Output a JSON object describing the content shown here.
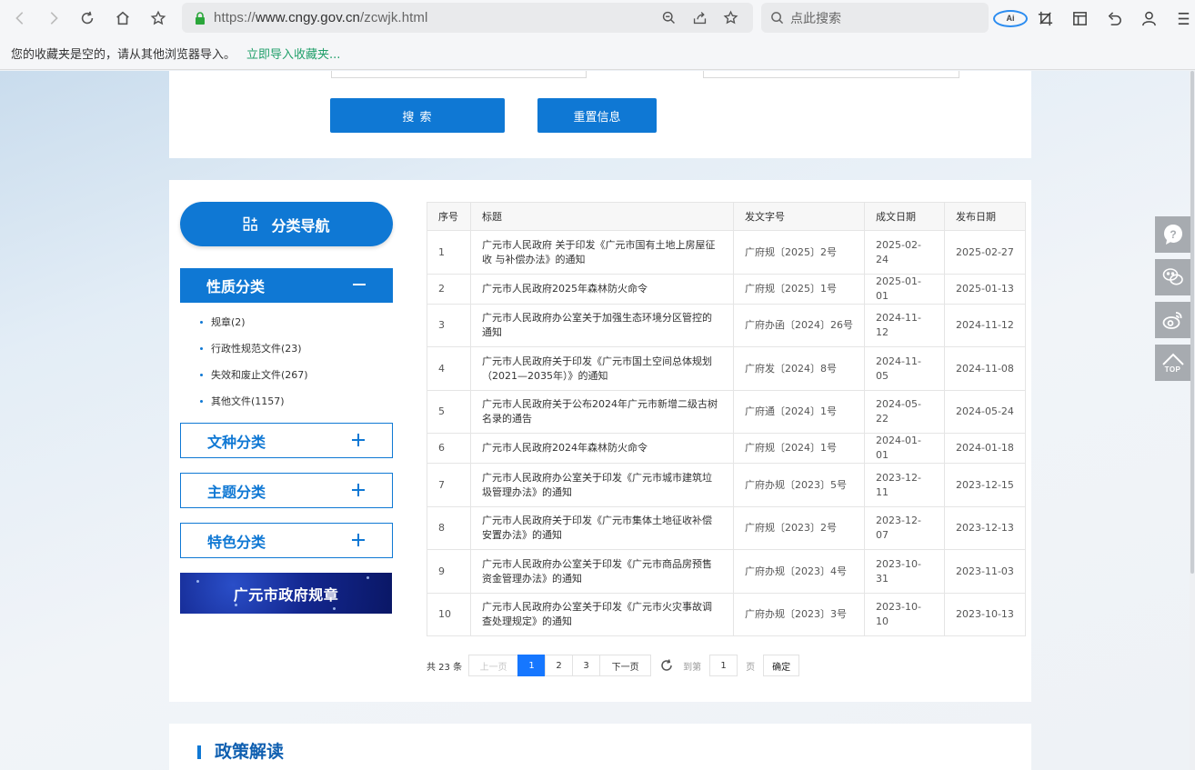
{
  "browser": {
    "url_prefix": "https://",
    "url_host": "www.cngy.gov.cn",
    "url_path": "/zcwjk.html",
    "search_placeholder": "点此搜索",
    "ai_label": "Ai",
    "favbar_message": "您的收藏夹是空的，请从其他浏览器导入。",
    "favbar_import": "立即导入收藏夹..."
  },
  "search_panel": {
    "search_button": "搜 索",
    "reset_button": "重置信息"
  },
  "sidebar": {
    "nav_title": "分类导航",
    "categories": [
      {
        "label": "性质分类",
        "expanded": true
      },
      {
        "label": "文种分类",
        "expanded": false
      },
      {
        "label": "主题分类",
        "expanded": false
      },
      {
        "label": "特色分类",
        "expanded": false
      }
    ],
    "nature_items": [
      "规章(2)",
      "行政性规范文件(23)",
      "失效和废止文件(267)",
      "其他文件(1157)"
    ],
    "banner_text": "广元市政府规章"
  },
  "table": {
    "headers": [
      "序号",
      "标题",
      "发文字号",
      "成文日期",
      "发布日期"
    ],
    "rows": [
      {
        "no": "1",
        "title": "广元市人民政府 关于印发《广元市国有土地上房屋征收 与补偿办法》的通知",
        "code": "广府规〔2025〕2号",
        "written": "2025-02-24",
        "published": "2025-02-27"
      },
      {
        "no": "2",
        "title": "广元市人民政府2025年森林防火命令",
        "code": "广府规〔2025〕1号",
        "written": "2025-01-01",
        "published": "2025-01-13"
      },
      {
        "no": "3",
        "title": "广元市人民政府办公室关于加强生态环境分区管控的通知",
        "code": "广府办函〔2024〕26号",
        "written": "2024-11-12",
        "published": "2024-11-12"
      },
      {
        "no": "4",
        "title": "广元市人民政府关于印发《广元市国土空间总体规划（2021—2035年）》的通知",
        "code": "广府发〔2024〕8号",
        "written": "2024-11-05",
        "published": "2024-11-08"
      },
      {
        "no": "5",
        "title": "广元市人民政府关于公布2024年广元市新增二级古树名录的通告",
        "code": "广府通〔2024〕1号",
        "written": "2024-05-22",
        "published": "2024-05-24"
      },
      {
        "no": "6",
        "title": "广元市人民政府2024年森林防火命令",
        "code": "广府规〔2024〕1号",
        "written": "2024-01-01",
        "published": "2024-01-18"
      },
      {
        "no": "7",
        "title": "广元市人民政府办公室关于印发《广元市城市建筑垃圾管理办法》的通知",
        "code": "广府办规〔2023〕5号",
        "written": "2023-12-11",
        "published": "2023-12-15"
      },
      {
        "no": "8",
        "title": "广元市人民政府关于印发《广元市集体土地征收补偿安置办法》的通知",
        "code": "广府规〔2023〕2号",
        "written": "2023-12-07",
        "published": "2023-12-13"
      },
      {
        "no": "9",
        "title": "广元市人民政府办公室关于印发《广元市商品房预售资金管理办法》的通知",
        "code": "广府办规〔2023〕4号",
        "written": "2023-10-31",
        "published": "2023-11-03"
      },
      {
        "no": "10",
        "title": "广元市人民政府办公室关于印发《广元市火灾事故调查处理规定》的通知",
        "code": "广府办规〔2023〕3号",
        "written": "2023-10-10",
        "published": "2023-10-13"
      }
    ]
  },
  "pager": {
    "total": "共 23 条",
    "prev": "上一页",
    "pages": [
      "1",
      "2",
      "3"
    ],
    "current": "1",
    "next": "下一页",
    "goto_label": "到第",
    "goto_value": "1",
    "page_unit": "页",
    "confirm": "确定"
  },
  "section": {
    "title": "政策解读"
  },
  "side_tools": {
    "top_label": "TOP"
  },
  "colors": {
    "primary": "#0f78d4",
    "pager_active": "#1677ff",
    "import_link": "#22a06b"
  }
}
